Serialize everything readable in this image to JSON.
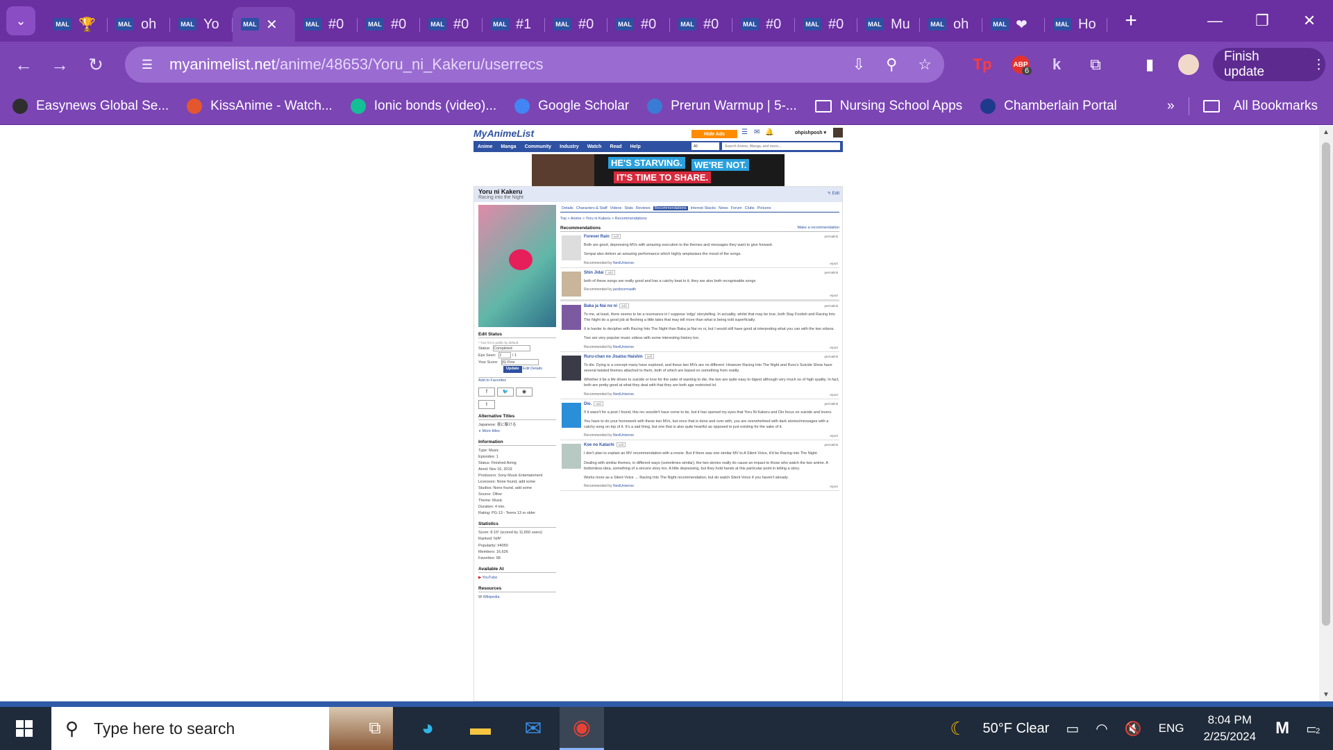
{
  "browser": {
    "tabs": [
      {
        "icon": "MAL",
        "title": "🏆",
        "active": false
      },
      {
        "icon": "MAL",
        "title": "oh",
        "active": false
      },
      {
        "icon": "MAL",
        "title": "Yo",
        "active": false
      },
      {
        "icon": "MAL",
        "title": "",
        "active": true
      },
      {
        "icon": "MAL",
        "title": "#0",
        "active": false
      },
      {
        "icon": "MAL",
        "title": "#0",
        "active": false
      },
      {
        "icon": "MAL",
        "title": "#0",
        "active": false
      },
      {
        "icon": "MAL",
        "title": "#1",
        "active": false
      },
      {
        "icon": "MAL",
        "title": "#0",
        "active": false
      },
      {
        "icon": "MAL",
        "title": "#0",
        "active": false
      },
      {
        "icon": "MAL",
        "title": "#0",
        "active": false
      },
      {
        "icon": "MAL",
        "title": "#0",
        "active": false
      },
      {
        "icon": "MAL",
        "title": "#0",
        "active": false
      },
      {
        "icon": "MAL",
        "title": "Mu",
        "active": false
      },
      {
        "icon": "MAL",
        "title": "oh",
        "active": false
      },
      {
        "icon": "MAL",
        "title": "❤",
        "active": false
      },
      {
        "icon": "MAL",
        "title": "Ho",
        "active": false
      }
    ],
    "url_host": "myanimelist.net",
    "url_path": "/anime/48653/Yoru_ni_Kakeru/userrecs",
    "ext_badge": "6",
    "finish_update": "Finish update",
    "bookmarks": [
      {
        "label": "Easynews Global Se...",
        "icon": "easynews-icon",
        "color": "#2e2e2e"
      },
      {
        "label": "KissAnime - Watch...",
        "icon": "kissanime-icon",
        "color": "#e4572e"
      },
      {
        "label": "Ionic bonds (video)...",
        "icon": "khan-icon",
        "color": "#14bf96"
      },
      {
        "label": "Google Scholar",
        "icon": "scholar-icon",
        "color": "#4285f4"
      },
      {
        "label": "Prerun Warmup | 5-...",
        "icon": "rw-icon",
        "color": "#3a7bd5"
      },
      {
        "label": "Nursing School Apps",
        "icon": "folder-icon",
        "color": ""
      },
      {
        "label": "Chamberlain Portal",
        "icon": "chamberlain-icon",
        "color": "#1e3a8a"
      }
    ],
    "all_bookmarks": "All Bookmarks"
  },
  "mal": {
    "logo": "MyAnimeList",
    "hide_ads": "Hide Ads",
    "user": "ohpishposh ▾",
    "nav": [
      "Anime",
      "Manga",
      "Community",
      "Industry",
      "Watch",
      "Read",
      "Help"
    ],
    "search_filter": "All",
    "search_placeholder": "Search Anime, Manga, and more...",
    "ad_line1": "HE'S STARVING.",
    "ad_line1b": "WE'RE NOT.",
    "ad_line2": "IT'S TIME TO SHARE.",
    "title": "Yoru ni Kakeru",
    "title_en": "Racing into the Night",
    "edit": "✎ Edit",
    "subtabs": [
      "Details",
      "Characters & Staff",
      "Videos",
      "Stats",
      "Reviews",
      "Recommendations",
      "Interest Stacks",
      "News",
      "Forum",
      "Clubs",
      "Pictures"
    ],
    "active_subtab": "Recommendations",
    "breadcrumb": "Top  >  Anime  >  Yoru ni Kakeru  >  Recommendations",
    "rec_heading": "Recommendations",
    "make_rec": "Make a recommendation",
    "sidebar": {
      "edit_status": "Edit Status",
      "note": "* Your list is public by default.",
      "status_label": "Status:",
      "status_value": "Completed",
      "eps_label": "Eps Seen:",
      "eps_value": "1",
      "eps_total": "/ 1",
      "score_label": "Your Score:",
      "score_value": "(6) Fine",
      "update": "Update",
      "edit_details": "Edit Details",
      "add_fav": "Add to Favorites",
      "alt_titles": "Alternative Titles",
      "japanese": "Japanese: 夜に駆ける",
      "more_titles": "∨ More titles",
      "information": "Information",
      "info": [
        "Type: Music",
        "Episodes: 1",
        "Status: Finished Airing",
        "Aired: Nov 16, 2019",
        "Producers: Sony Music Entertainment",
        "Licensors: None found, add some",
        "Studios: None found, add some",
        "Source: Other",
        "Theme: Music",
        "Duration: 4 min.",
        "Rating: PG-13 - Teens 13 or older"
      ],
      "statistics": "Statistics",
      "stats": [
        "Score: 8.15² (scored by 11,650 users)",
        "Ranked: N/A²",
        "Popularity: #4050",
        "Members: 16,626",
        "Favorites: 98"
      ],
      "available_at": "Available At",
      "youtube": "YouTube",
      "resources": "Resources",
      "wikipedia": "Wikipedia"
    },
    "recs": [
      {
        "title": "Forever Rain",
        "texts": [
          "Both are good, depressing MVs with amazing execution to the themes and messages they want to give forward.",
          "Senpai also deliver an amazing performance which highly amplasises the mood of the songs."
        ],
        "by": "NextUniverse",
        "big": false,
        "thumb": "#ddd"
      },
      {
        "title": "Shin Jidai",
        "texts": [
          "both of these songs are really good and has a catchy beat to it, they are also both recognisable songs"
        ],
        "by": "jacobcorrraaith",
        "big": false,
        "thumb": "#c9b59a"
      },
      {
        "title": "Baka ja Nai no ni",
        "texts": [
          "To me, at least, there seems to be a resonance in I suppose 'edgy' storytelling. In actuality, whilst that may be true, both Stay Foolish and Racing Into The Night do a good job at fleshing a little tales that may tell more than what is being told superficially.",
          "It is harder to decipher with Racing Into The Night than Baka ja Nai no ni, but I would still have good at interpreting what you can with the two videos.",
          "Two are very popular music videos with some interesting history too."
        ],
        "by": "NextUniverse",
        "big": true,
        "thumb": "#7b5aa0"
      },
      {
        "title": "Ruru-chan no Jisatsu Haishin",
        "texts": [
          "To die. Dying is a concept many have explored, and these two MVs are no different. However Racing Into The Night and Ruru's Suicide Show have several twisted themes attached to them, both of which are based on something from reality.",
          "Whether it be a life driven to suicide or love for the sake of wanting to die, the two are quite easy to digest although very much so of high quality. In fact, both are pretty good at what they deal with that they are both age restricted lol."
        ],
        "by": "NextUniverse",
        "big": false,
        "thumb": "#3b3b48"
      },
      {
        "title": "Dio.",
        "texts": [
          "If it wasn't for a post I found, this rec wouldn't have come to be, but it has opened my eyes that Yoru Ni Kakeru and Dio focus on suicide and lovers.",
          "You have to do your homework with these two MVs, but once that is done and over with, you are overwhelmed with dark stories/messages with a catchy song on top of it. It's a sad thing, but one that is also quite heartful as opposed to just existing for the sake of it."
        ],
        "by": "NextUniverse",
        "big": false,
        "thumb": "#2a8ed8"
      },
      {
        "title": "Koe no Katachi",
        "texts": [
          "I don't plan to explain an MV recommendation with a movie. But if there was one similar MV to A Silent Voice, it'd be Racing into The Night.",
          "Dealing with similar themes, in different ways (sometimes similar), the two stories really do cause an impact to those who watch the two anime. A bottomless idea, something of a sincere story too. A little depressing, but they hold hands at this particular point in telling a story.",
          "Works more as a Silent Voice → Racing Into The Night recommendation, but do watch Silent Voice if you haven't already."
        ],
        "by": "NextUniverse",
        "big": false,
        "thumb": "#b7c9c2"
      }
    ],
    "permalink": "permalink",
    "report": "report",
    "add": "add",
    "recommended_by": "Recommended by "
  },
  "taskbar": {
    "search_placeholder": "Type here to search",
    "weather": "50°F  Clear",
    "lang": "ENG",
    "time": "8:04 PM",
    "date": "2/25/2024",
    "notif_count": "2"
  }
}
